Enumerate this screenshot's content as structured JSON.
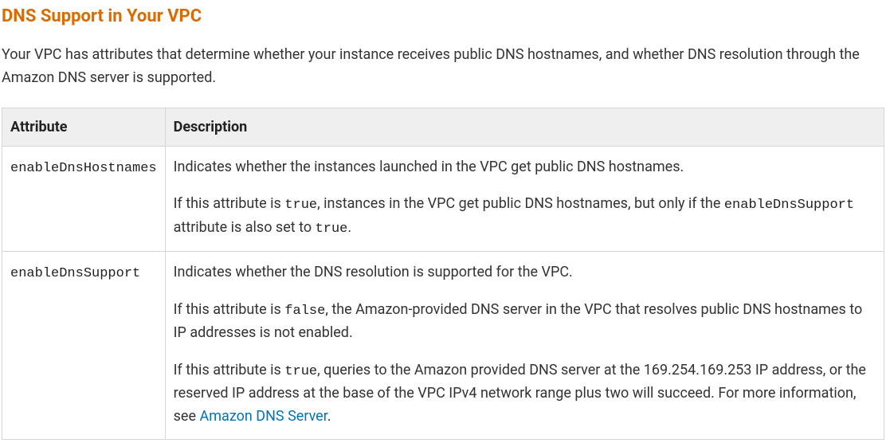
{
  "heading": "DNS Support in Your VPC",
  "intro": "Your VPC has attributes that determine whether your instance receives public DNS hostnames, and whether DNS resolution through the Amazon DNS server is supported.",
  "table": {
    "headers": {
      "attribute": "Attribute",
      "description": "Description"
    },
    "rows": [
      {
        "attr": "enableDnsHostnames",
        "p1": "Indicates whether the instances launched in the VPC get public DNS hostnames.",
        "p2a": "If this attribute is ",
        "p2code1": "true",
        "p2b": ", instances in the VPC get public DNS hostnames, but only if the ",
        "p2code2": "enableDnsSupport",
        "p2c": " attribute is also set to ",
        "p2code3": "true",
        "p2d": "."
      },
      {
        "attr": "enableDnsSupport",
        "p1": "Indicates whether the DNS resolution is supported for the VPC.",
        "p2a": "If this attribute is ",
        "p2code1": "false",
        "p2b": ", the Amazon-provided DNS server in the VPC that resolves public DNS hostnames to IP addresses is not enabled.",
        "p3a": "If this attribute is ",
        "p3code1": "true",
        "p3b": ", queries to the Amazon provided DNS server at the 169.254.169.253 IP address, or the reserved IP address at the base of the VPC IPv4 network range plus two will succeed. For more information, see ",
        "p3link": "Amazon DNS Server",
        "p3c": "."
      }
    ]
  }
}
